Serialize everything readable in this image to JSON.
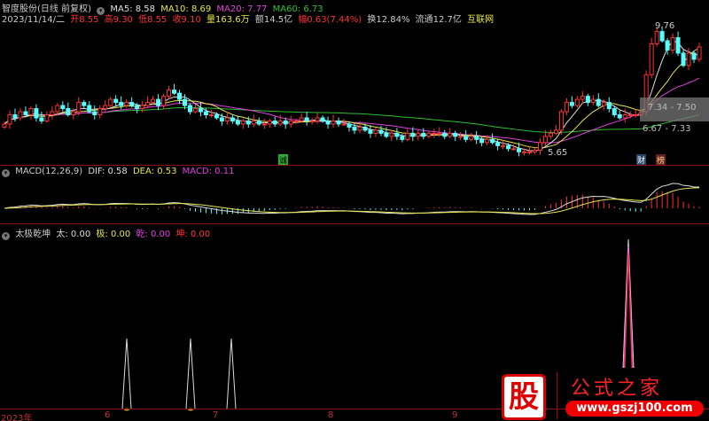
{
  "header": {
    "title": "智度股份(日线 前复权)",
    "ma5": "MA5: 8.58",
    "ma10": "MA10: 8.69",
    "ma20": "MA20: 7.77",
    "ma60": "MA60: 6.73"
  },
  "quote": {
    "date": "2023/11/14/二",
    "open": "开8.55",
    "high": "高9.30",
    "low": "低8.55",
    "close": "收9.10",
    "volume": "量163.6万",
    "amount": "额14.5亿",
    "change": "幅0.63(7.44%)",
    "turnover": "换12.84%",
    "float": "流通12.7亿",
    "link": "互联网"
  },
  "price_labels": {
    "high": "9.76",
    "low": "5.65",
    "box1": "7.34 - 7.50",
    "box2": "6.67 - 7.33"
  },
  "markers": {
    "cheng": "诚",
    "cai": "财",
    "bang": "榜"
  },
  "macd": {
    "title": "MACD(12,26,9)",
    "dif": "DIF: 0.58",
    "dea": "DEA: 0.53",
    "macd": "MACD: 0.11"
  },
  "indicator": {
    "title": "太极乾坤",
    "tai": "太: 0.00",
    "ji": "极: 0.00",
    "qian": "乾: 0.00",
    "kun": "坤: 0.00"
  },
  "axis": [
    "2023年",
    "6",
    "7",
    "8",
    "9"
  ],
  "logo": {
    "char": "股",
    "name": "公式之家",
    "url": "www.gszj100.com"
  },
  "colors": {
    "up": "#ff3232",
    "down": "#54ffff",
    "ma5": "#e0e0e0",
    "ma10": "#e6e64c",
    "ma20": "#e040e0",
    "ma60": "#30c030"
  },
  "chart_data": {
    "type": "candlestick",
    "closes": [
      6.6,
      6.9,
      6.8,
      7.0,
      6.9,
      7.1,
      6.8,
      6.7,
      6.9,
      7.0,
      7.2,
      7.1,
      6.9,
      7.0,
      7.3,
      7.2,
      7.0,
      6.9,
      7.1,
      7.2,
      7.4,
      7.3,
      7.2,
      7.3,
      7.2,
      7.1,
      7.2,
      7.3,
      7.4,
      7.2,
      7.5,
      7.7,
      7.6,
      7.4,
      7.2,
      7.0,
      7.1,
      7.0,
      6.9,
      6.9,
      6.8,
      6.7,
      6.8,
      6.7,
      6.6,
      6.7,
      6.6,
      6.7,
      6.6,
      6.6,
      6.7,
      6.6,
      6.7,
      6.6,
      6.7,
      6.7,
      6.8,
      6.7,
      6.7,
      6.8,
      6.7,
      6.6,
      6.7,
      6.6,
      6.6,
      6.5,
      6.4,
      6.5,
      6.4,
      6.3,
      6.4,
      6.3,
      6.2,
      6.3,
      6.2,
      6.1,
      6.3,
      6.2,
      6.3,
      6.2,
      6.3,
      6.3,
      6.3,
      6.2,
      6.3,
      6.2,
      6.2,
      6.1,
      6.2,
      6.1,
      6.0,
      6.1,
      6.0,
      5.9,
      5.9,
      5.8,
      5.8,
      5.7,
      5.7,
      5.7,
      5.75,
      6.0,
      6.2,
      6.3,
      6.4,
      7.0,
      7.3,
      7.2,
      7.4,
      7.5,
      7.3,
      7.4,
      7.2,
      7.3,
      7.1,
      6.9,
      6.8,
      6.9,
      6.9,
      6.9,
      7.0,
      8.2,
      9.2,
      9.6,
      9.3,
      9.0,
      9.4,
      8.9,
      8.5,
      8.9,
      8.7,
      9.1
    ],
    "ylim": [
      5.2,
      9.9
    ]
  }
}
